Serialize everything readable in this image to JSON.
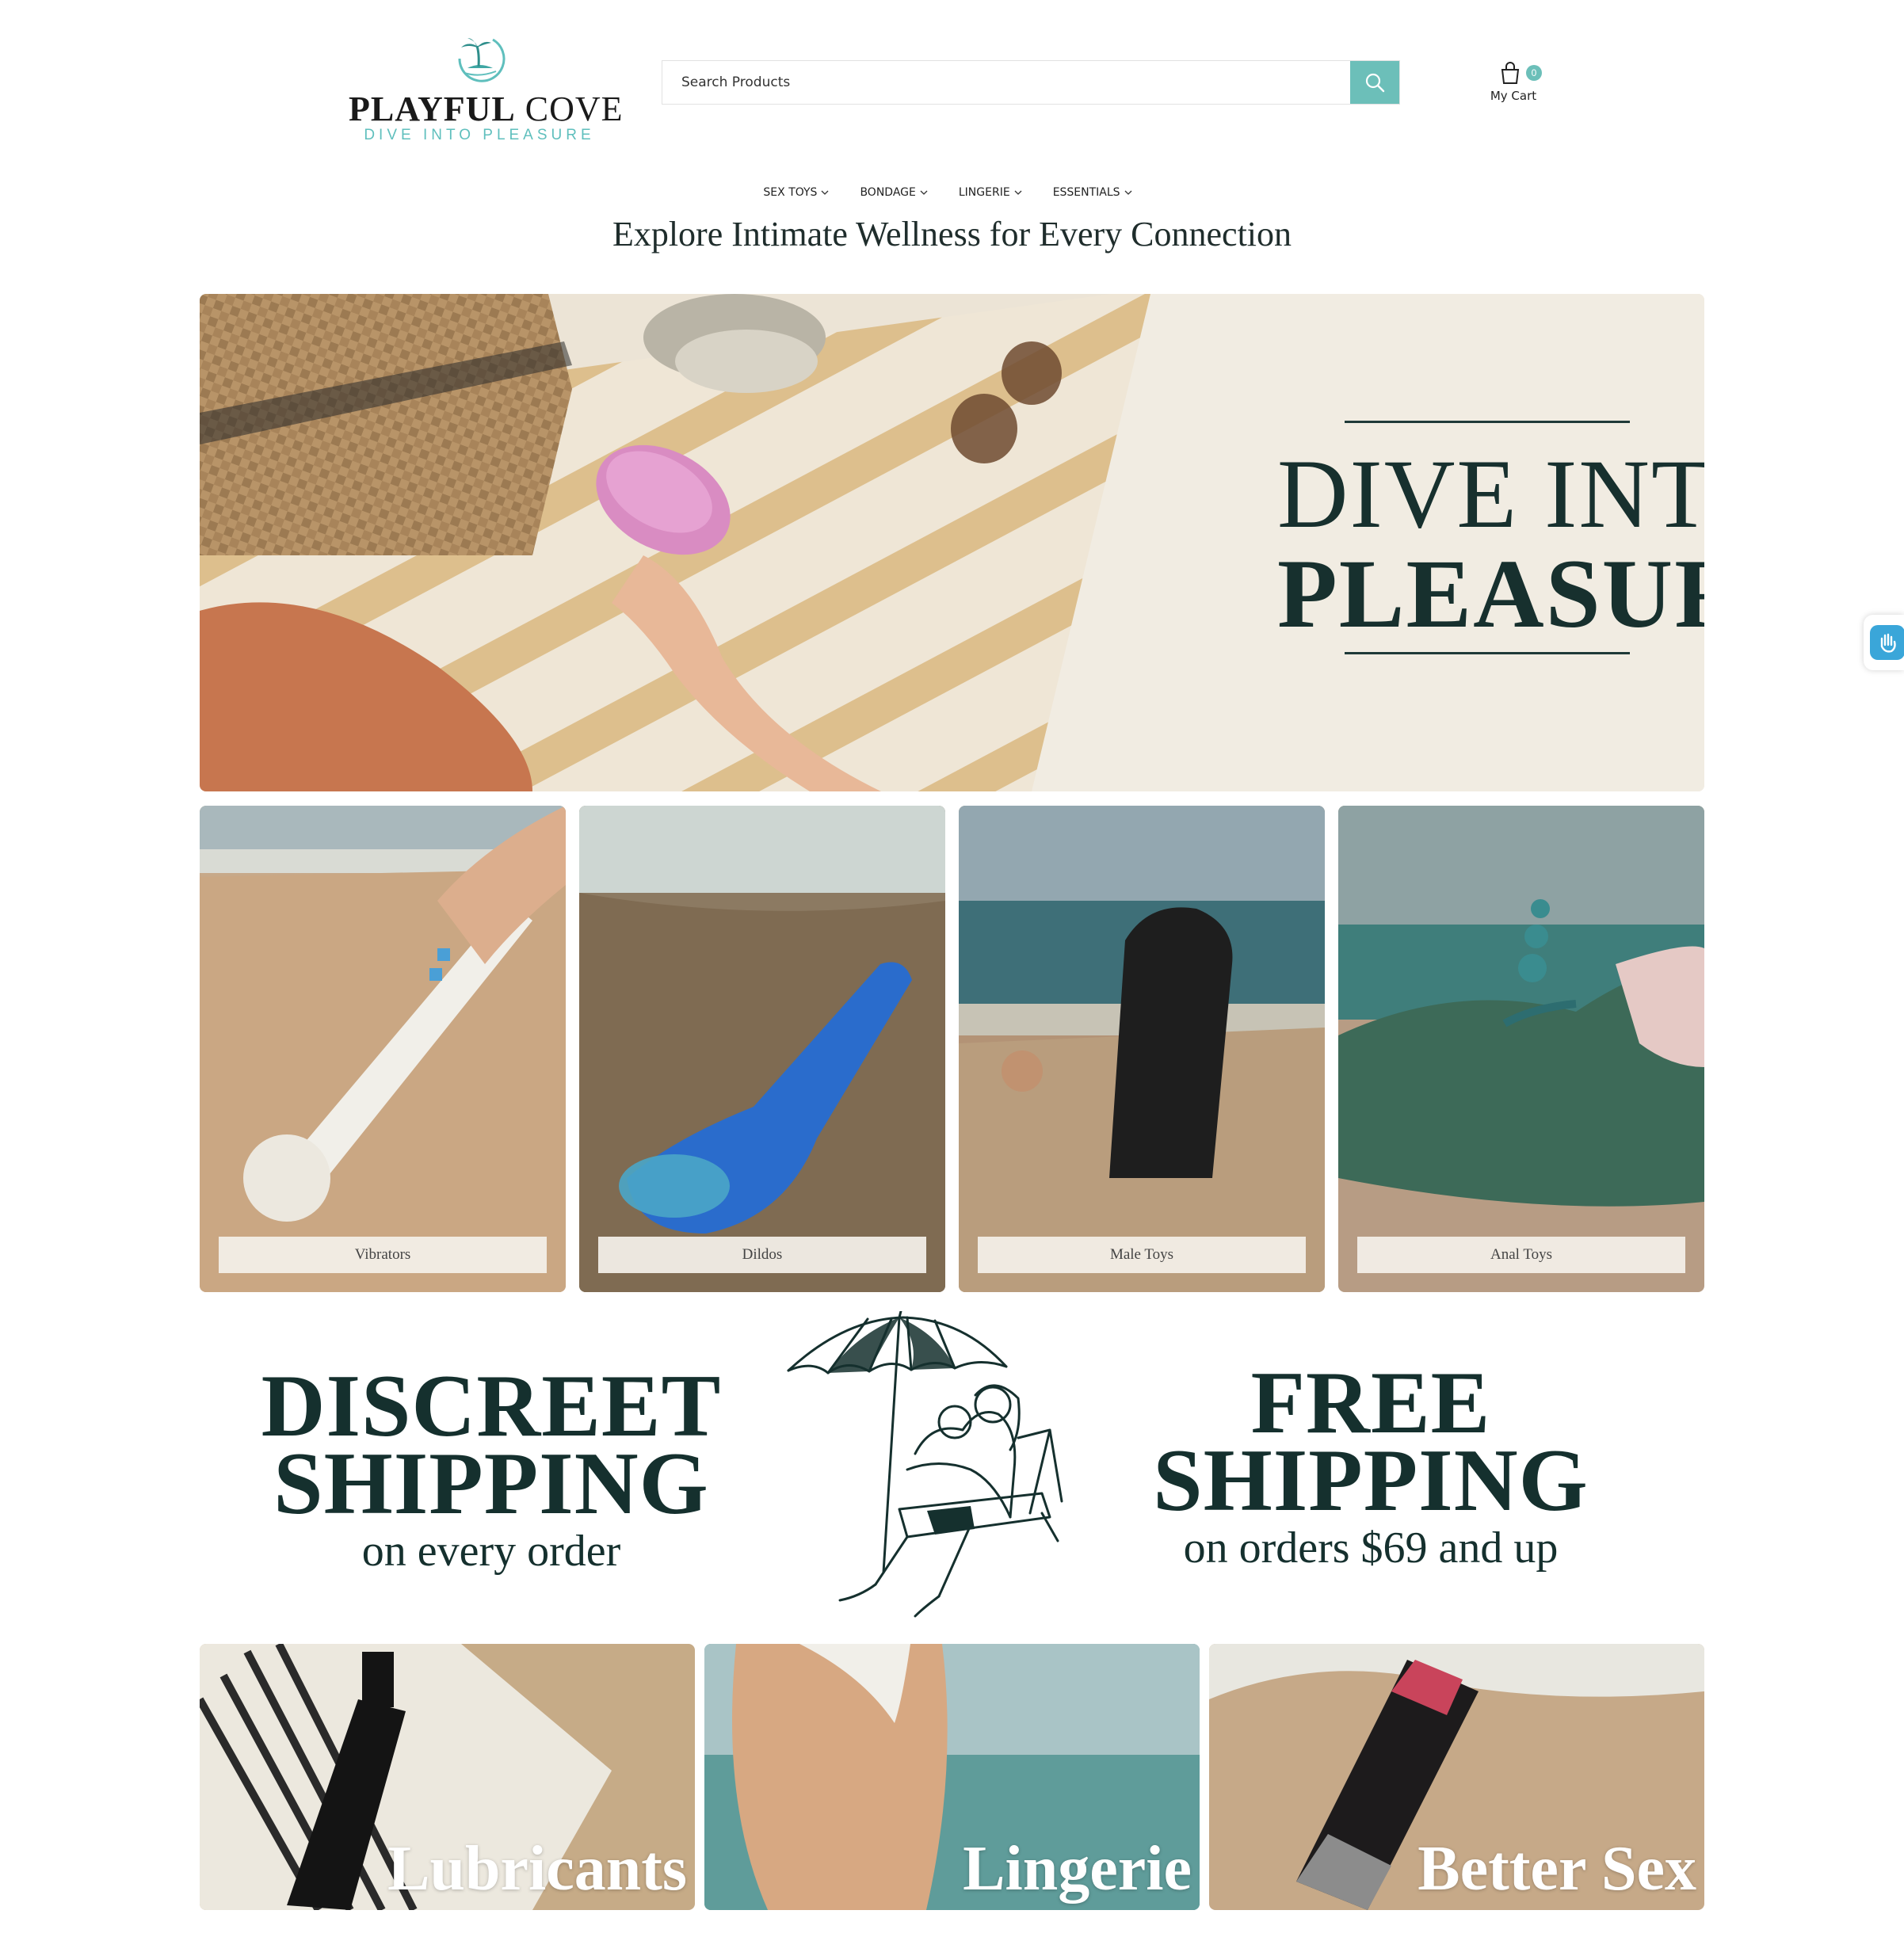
{
  "brand": {
    "name_bold": "PLAYFUL",
    "name_light": "COVE",
    "tagline": "DIVE INTO PLEASURE",
    "accent_color": "#6cbfb9"
  },
  "search": {
    "placeholder": "Search Products",
    "icon": "search-icon"
  },
  "cart": {
    "count": "0",
    "label": "My Cart",
    "icon": "shopping-bag-icon"
  },
  "nav": {
    "items": [
      {
        "label": "SEX TOYS"
      },
      {
        "label": "BONDAGE"
      },
      {
        "label": "LINGERIE"
      },
      {
        "label": "ESSENTIALS"
      }
    ]
  },
  "page": {
    "tagline": "Explore Intimate Wellness for Every Connection"
  },
  "hero": {
    "line1": "DIVE INTO",
    "line2": "PLEASURE"
  },
  "categories": [
    {
      "label": "Vibrators"
    },
    {
      "label": "Dildos"
    },
    {
      "label": "Male Toys"
    },
    {
      "label": "Anal Toys"
    }
  ],
  "shipping": {
    "discreet_line1": "DISCREET",
    "discreet_line2": "SHIPPING",
    "discreet_line3": "on every order",
    "free_line1": "FREE",
    "free_line2": "SHIPPING",
    "free_line3": "on orders $69 and up"
  },
  "bottom_categories": [
    {
      "label": "Lubricants"
    },
    {
      "label": "Lingerie"
    },
    {
      "label": "Better Sex"
    }
  ],
  "accessibility": {
    "icon": "accessibility-hand-icon"
  }
}
